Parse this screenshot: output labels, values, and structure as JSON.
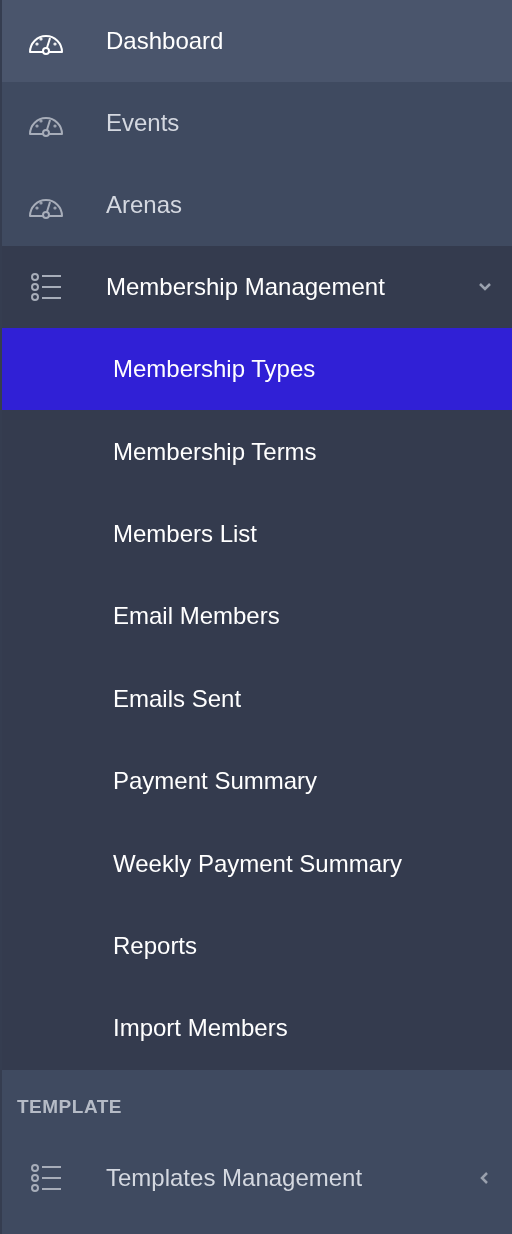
{
  "sidebar": {
    "items": [
      {
        "label": "Dashboard",
        "kind": "gauge",
        "selected": true
      },
      {
        "label": "Events",
        "kind": "gauge",
        "selected": false
      },
      {
        "label": "Arenas",
        "kind": "gauge",
        "selected": false
      },
      {
        "label": "Membership Management",
        "kind": "list",
        "selected": false,
        "expanded": true,
        "children": [
          {
            "label": "Membership Types",
            "selected": true
          },
          {
            "label": "Membership Terms",
            "selected": false
          },
          {
            "label": "Members List",
            "selected": false
          },
          {
            "label": "Email Members",
            "selected": false
          },
          {
            "label": "Emails Sent",
            "selected": false
          },
          {
            "label": "Payment Summary",
            "selected": false
          },
          {
            "label": "Weekly Payment Summary",
            "selected": false
          },
          {
            "label": "Reports",
            "selected": false
          },
          {
            "label": "Import Members",
            "selected": false
          }
        ]
      }
    ],
    "sections": [
      {
        "heading": "TEMPLATE",
        "items": [
          {
            "label": "Templates Management",
            "kind": "list",
            "selected": false,
            "expanded": false
          }
        ]
      }
    ]
  }
}
